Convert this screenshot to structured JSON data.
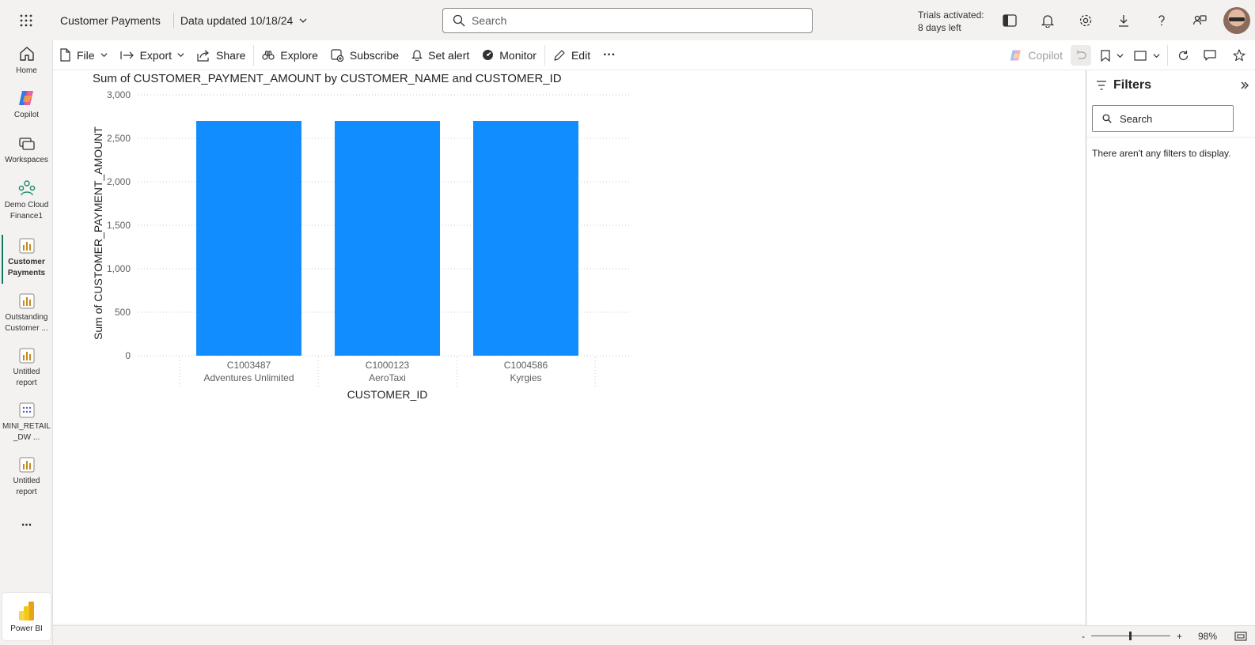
{
  "header": {
    "report_title": "Customer Payments",
    "data_updated": "Data updated 10/18/24",
    "search_placeholder": "Search",
    "trial_line1": "Trials activated:",
    "trial_line2": "8 days left"
  },
  "nav": {
    "items": [
      {
        "label": "Home",
        "icon": "home-icon"
      },
      {
        "label": "Copilot",
        "icon": "copilot-icon"
      },
      {
        "label": "Workspaces",
        "icon": "workspaces-icon"
      },
      {
        "label": "Demo Cloud Finance1",
        "icon": "workspace-group-icon"
      },
      {
        "label": "Customer Payments",
        "icon": "report-icon",
        "active": true
      },
      {
        "label": "Outstanding Customer ...",
        "icon": "report-icon"
      },
      {
        "label": "Untitled report",
        "icon": "report-icon"
      },
      {
        "label": "MINI_RETAIL _DW ...",
        "icon": "semantic-model-icon"
      },
      {
        "label": "Untitled report",
        "icon": "report-icon"
      }
    ],
    "more": "...",
    "app": "Power BI"
  },
  "toolbar": {
    "file": "File",
    "export": "Export",
    "share": "Share",
    "explore": "Explore",
    "subscribe": "Subscribe",
    "set_alert": "Set alert",
    "monitor": "Monitor",
    "edit": "Edit",
    "more": "···",
    "copilot": "Copilot"
  },
  "filters": {
    "title": "Filters",
    "search_placeholder": "Search",
    "empty_message": "There aren't any filters to display."
  },
  "status": {
    "zoom_minus": "-",
    "zoom_plus": "+",
    "zoom_level": "98%"
  },
  "chart_data": {
    "type": "bar",
    "title": "Sum of CUSTOMER_PAYMENT_AMOUNT by CUSTOMER_NAME and CUSTOMER_ID",
    "xlabel": "CUSTOMER_ID",
    "ylabel": "Sum of CUSTOMER_PAYMENT_AMOUNT",
    "categories": [
      "C1003487",
      "C1000123",
      "C1004586"
    ],
    "category_subtitles": [
      "Adventures Unlimited",
      "AeroTaxi",
      "Kyrgies"
    ],
    "values": [
      2700,
      2700,
      2700
    ],
    "ylim": [
      0,
      3000
    ],
    "yticks": [
      0,
      500,
      1000,
      1500,
      2000,
      2500,
      3000
    ],
    "ytick_labels": [
      "0",
      "500",
      "1,000",
      "1,500",
      "2,000",
      "2,500",
      "3,000"
    ],
    "bar_color": "#118DFF",
    "grid": true
  }
}
